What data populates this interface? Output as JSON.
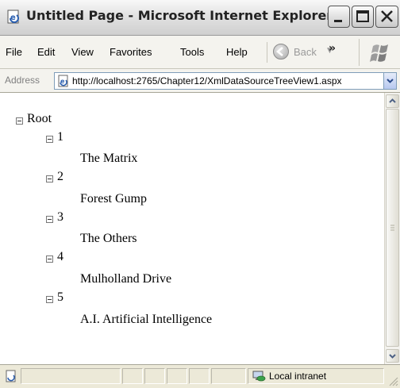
{
  "window": {
    "title": "Untitled Page - Microsoft Internet Explorer"
  },
  "menu": {
    "items": [
      {
        "label": "File"
      },
      {
        "label": "Edit"
      },
      {
        "label": "View"
      },
      {
        "label": "Favorites"
      },
      {
        "label": "Tools"
      },
      {
        "label": "Help"
      }
    ],
    "back_label": "Back",
    "overflow_glyph": "»"
  },
  "address": {
    "label": "Address",
    "url": "http://localhost:2765/Chapter12/XmlDataSourceTreeView1.aspx"
  },
  "tree": {
    "root": "Root",
    "items": [
      {
        "id": "1",
        "title": "The Matrix"
      },
      {
        "id": "2",
        "title": "Forest Gump"
      },
      {
        "id": "3",
        "title": "The Others"
      },
      {
        "id": "4",
        "title": "Mulholland Drive"
      },
      {
        "id": "5",
        "title": "A.I. Artificial Intelligence"
      }
    ]
  },
  "status": {
    "zone": "Local intranet"
  },
  "icons": {
    "app": "ie-page-icon",
    "minimize": "minimize-icon",
    "maximize": "maximize-icon",
    "close": "close-icon",
    "back": "back-arrow-icon",
    "logo": "windows-flag-icon",
    "page": "page-icon",
    "zone": "intranet-icon"
  }
}
